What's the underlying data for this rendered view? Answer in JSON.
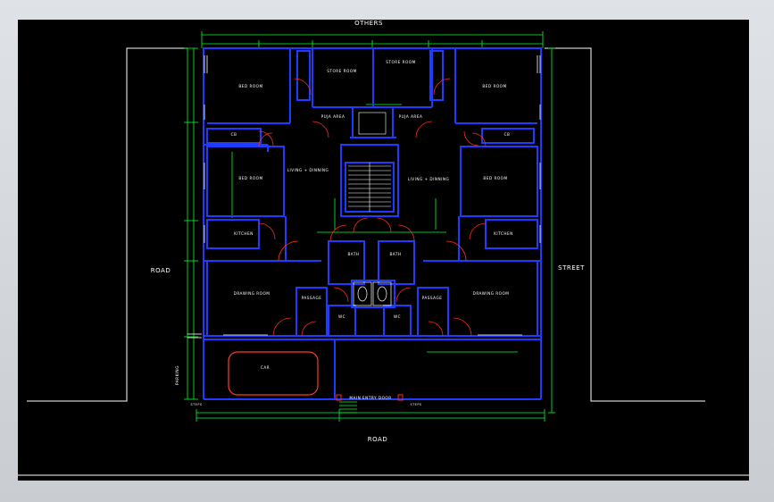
{
  "labels": {
    "top": "OTHERS",
    "left": "ROAD",
    "right": "STREET",
    "bottom": "ROAD"
  },
  "rooms": {
    "bedroom1_left": "BED ROOM",
    "bedroom1_right": "BED ROOM",
    "store_left": "STORE ROOM",
    "store_right": "STORE ROOM",
    "puja_left": "PUJA AREA",
    "puja_right": "PUJA AREA",
    "bedroom2_left": "BED ROOM",
    "bedroom2_right": "BED ROOM",
    "living_left": "LIVING + DINNING",
    "living_right": "LIVING + DINNING",
    "kitchen_left": "KITCHEN",
    "kitchen_right": "KITCHEN",
    "bath_left": "BATH",
    "bath_right": "BATH",
    "drawing_left": "DRAWING ROOM",
    "drawing_right": "DRAWING ROOM",
    "passage_left": "PASSAGE",
    "passage_right": "PASSAGE",
    "wc_left": "WC",
    "wc_right": "WC",
    "car": "CAR",
    "parking": "PARKING",
    "main_entry": "MAIN ENTRY DOOR",
    "cb": "CB",
    "stair_left": "STEPS",
    "stair_right": "STEPS"
  },
  "colors": {
    "wall": "#1f3bff",
    "dimension": "#00ff2a",
    "door": "#ff2a1a",
    "text": "#ffffff",
    "boundary": "#ffffff",
    "window": "#ffffff",
    "furniture": "#ff3b1f"
  }
}
